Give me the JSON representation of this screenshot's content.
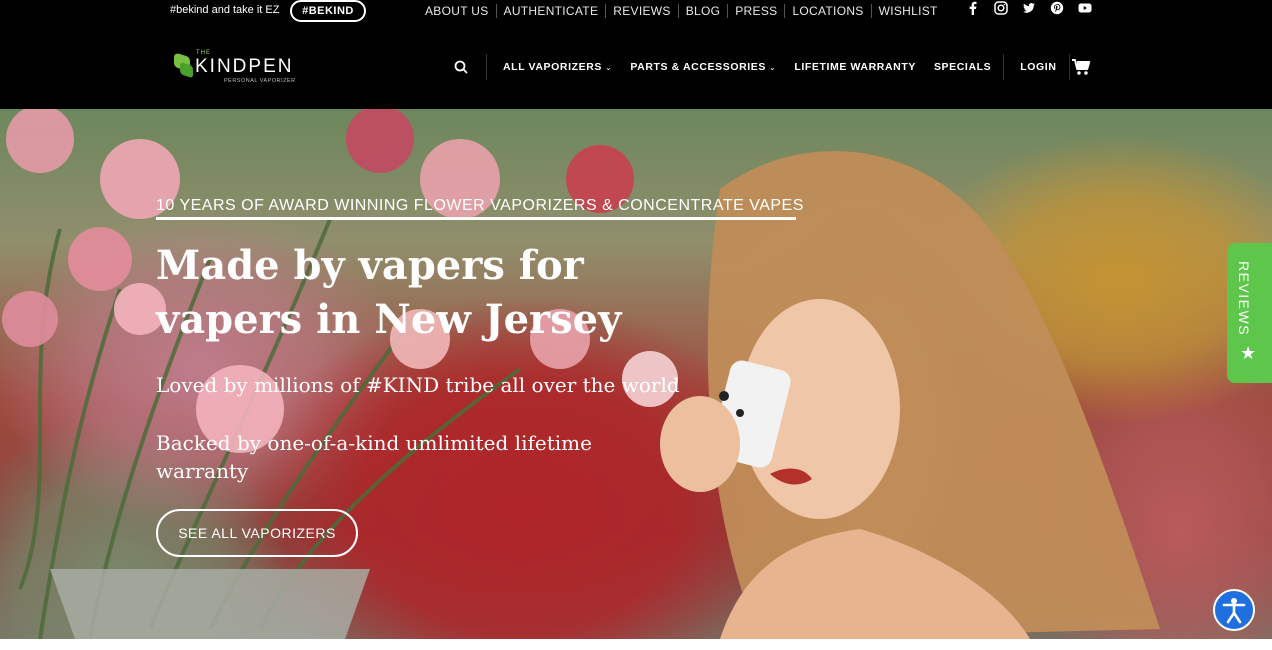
{
  "topbar": {
    "tagline": "#bekind and take it EZ",
    "pill": "#BEKIND",
    "links": [
      "ABOUT US",
      "AUTHENTICATE",
      "REVIEWS",
      "BLOG",
      "PRESS",
      "LOCATIONS",
      "WISHLIST"
    ],
    "social_icons": [
      "facebook-icon",
      "instagram-icon",
      "twitter-icon",
      "pinterest-icon",
      "youtube-icon"
    ]
  },
  "header": {
    "logo": {
      "the": "THE",
      "name": "KINDPEN",
      "sub": "PERSONAL VAPORIZER"
    },
    "nav": {
      "all_vaporizers": "ALL VAPORIZERS",
      "parts": "PARTS & ACCESSORIES",
      "warranty": "LIFETIME WARRANTY",
      "specials": "SPECIALS",
      "login": "LOGIN"
    }
  },
  "hero": {
    "eyebrow": "10 YEARS OF AWARD WINNING FLOWER VAPORIZERS & CONCENTRATE VAPES",
    "headline": "Made by vapers for vapers in New Jersey",
    "line1": "Loved by millions of #KIND tribe all over the world",
    "line2": "Backed by one-of-a-kind umlimited lifetime warranty",
    "cta": "SEE ALL VAPORIZERS"
  },
  "reviews_tab": {
    "label": "REVIEWS",
    "star": "★"
  },
  "colors": {
    "brand_green": "#5ec64a",
    "accessibility_blue": "#1f6fe0",
    "header_bg": "#000000"
  }
}
